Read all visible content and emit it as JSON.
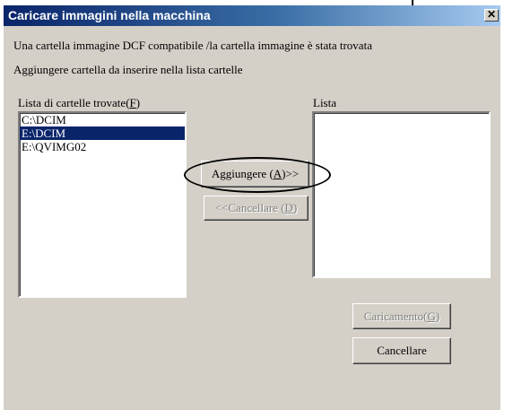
{
  "window": {
    "title": "Caricare immagini nella macchina",
    "close_glyph": "✕"
  },
  "messages": {
    "line1": "Una cartella immagine DCF compatibile /la cartella immagine è stata trovata",
    "line2": "Aggiungere cartella da inserire nella lista cartelle"
  },
  "found_list": {
    "label": "Lista di cartelle trovate(",
    "label_key": "F",
    "label_end": ")",
    "items": [
      "C:\\DCIM",
      "E:\\DCIM",
      "E:\\QVIMG02"
    ],
    "selected_index": 1
  },
  "target_list": {
    "label": "Lista",
    "items": []
  },
  "buttons": {
    "add": {
      "prefix": "Aggiungere (",
      "key": "A",
      "suffix": ")>>",
      "enabled": true
    },
    "remove": {
      "prefix": "<<Cancellare (",
      "key": "D",
      "suffix": ")",
      "enabled": false
    },
    "load": {
      "prefix": "Caricamento(",
      "key": "G",
      "suffix": ")",
      "enabled": false
    },
    "cancel": {
      "label": "Cancellare",
      "enabled": true
    }
  },
  "colors": {
    "titlebar_start": "#0a246a",
    "titlebar_end": "#a6caf0",
    "dialog_face": "#d4d0c8",
    "selection": "#0a246a"
  }
}
